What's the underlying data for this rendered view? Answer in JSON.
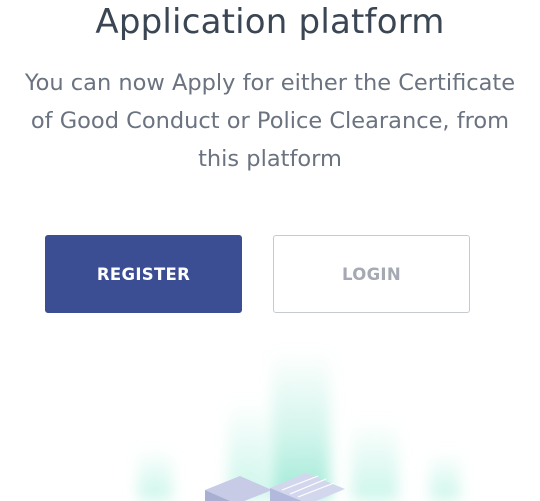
{
  "header": {
    "title": "Application platform",
    "description": "You can now Apply for either the Certificate of Good Conduct or Police Clearance, from this platform"
  },
  "actions": {
    "register_label": "REGISTER",
    "login_label": "LOGIN"
  },
  "colors": {
    "primary": "#3b4d93",
    "title_text": "#3b4654",
    "body_text": "#6b7380",
    "glow": "#7fe3c8",
    "server_top": "#c7cbe6"
  },
  "illustration": {
    "icon": "server-stack-illustration"
  }
}
